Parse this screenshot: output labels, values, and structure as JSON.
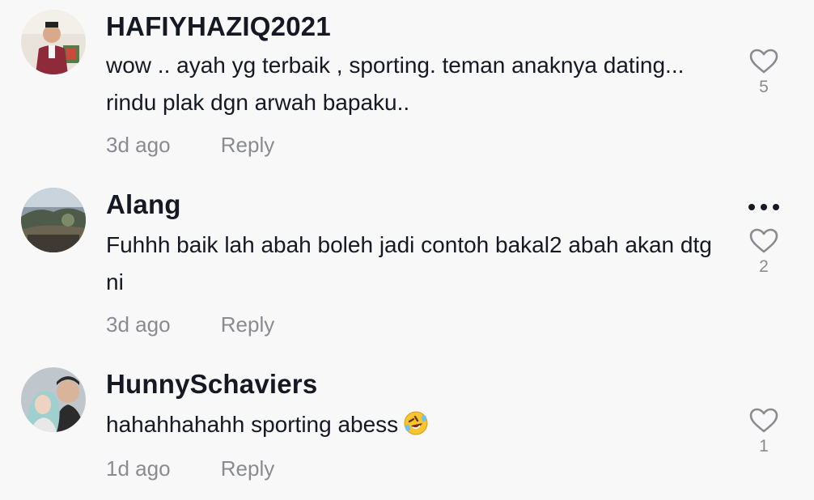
{
  "comments": [
    {
      "username": "HAFIYHAZIQ2021",
      "text": "wow .. ayah yg terbaik , sporting. teman anaknya dating... rindu plak dgn arwah bapaku..",
      "time": "3d ago",
      "reply_label": "Reply",
      "likes": "5"
    },
    {
      "username": "Alang",
      "text": "Fuhhh baik lah abah boleh jadi contoh bakal2 abah akan dtg ni",
      "time": "3d ago",
      "reply_label": "Reply",
      "likes": "2"
    },
    {
      "username": "HunnySchaviers",
      "text": "hahahhahahh sporting abess",
      "emoji": "rolling-on-floor-laughing",
      "time": "1d ago",
      "reply_label": "Reply",
      "likes": "1"
    }
  ],
  "icons": {
    "like": "heart-outline-icon",
    "more": "more-horizontal-icon"
  },
  "colors": {
    "background": "#f8f8f8",
    "primary_text": "#161823",
    "secondary_text": "#8a8b91"
  }
}
